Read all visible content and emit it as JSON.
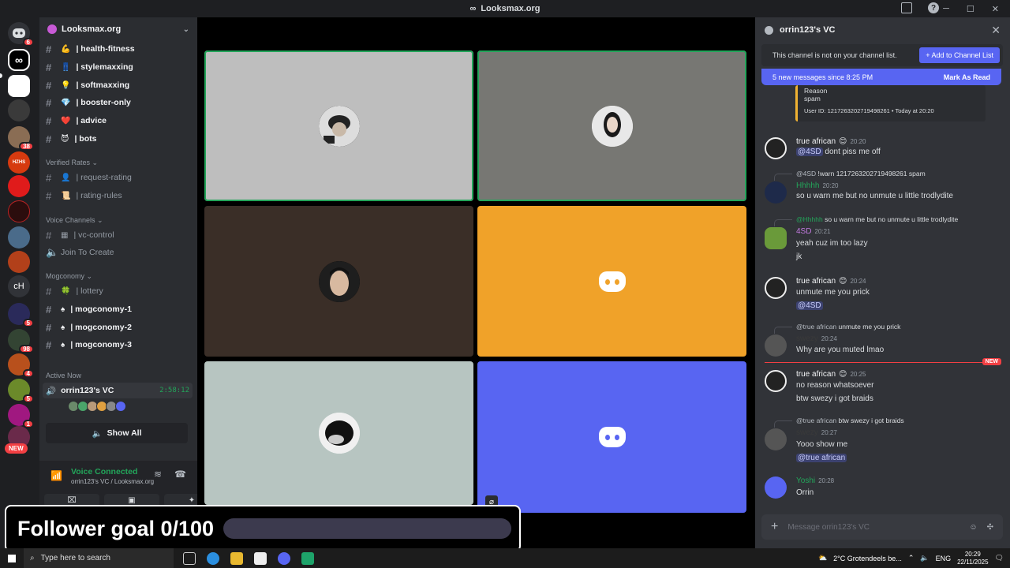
{
  "window": {
    "title": "Looksmax.org"
  },
  "rail": {
    "badges": [
      "6",
      "38",
      "5",
      "98",
      "4",
      "5",
      "1"
    ],
    "text_server": "cH",
    "new_label": "NEW"
  },
  "sidebar": {
    "guild_name": "Looksmax.org",
    "channels_top": [
      {
        "emoji": "💪",
        "label": "| health-fitness"
      },
      {
        "emoji": "👖",
        "label": "| stylemaxxing"
      },
      {
        "emoji": "💡",
        "label": "| softmaxxing"
      },
      {
        "emoji": "💎",
        "label": "| booster-only"
      },
      {
        "emoji": "❤️",
        "label": "| advice"
      },
      {
        "emoji": "😈",
        "label": "| bots"
      }
    ],
    "cat_verified": "Verified Rates ⌄",
    "channels_verified": [
      {
        "emoji": "👤",
        "label": "| request-rating"
      },
      {
        "emoji": "📜",
        "label": "| rating-rules"
      }
    ],
    "cat_voice": "Voice Channels ⌄",
    "vc_control": "| vc-control",
    "join_to_create": "Join To Create",
    "cat_mog": "Mogconomy ⌄",
    "lottery": "| lottery",
    "mog_channels": [
      "| mogconomy-1",
      "| mogconomy-2",
      "| mogconomy-3"
    ],
    "active_now": "Active Now",
    "active_vc": "orrin123's VC",
    "active_timer": "2:58:12",
    "show_all": "Show All"
  },
  "voice": {
    "status": "Voice Connected",
    "sub": "orrin123's VC / Looksmax.org"
  },
  "goal": {
    "text": "Follower goal 0/100",
    "current": 0,
    "target": 100
  },
  "chat": {
    "title": "orrin123's VC",
    "notice": "This channel is not on your channel list.",
    "add_btn": "+ Add to Channel List",
    "unread": "5 new messages since 8:25 PM",
    "mark_read": "Mark As Read",
    "embed_reason_label": "Reason",
    "embed_reason": "spam",
    "embed_uid": "User ID: 1217263202719498261 • Today at 20:20",
    "messages": [
      {
        "name": "true african",
        "badge": "😊",
        "time": "20:20",
        "lines": [
          "@4SD",
          " dont piss me off"
        ]
      },
      {
        "reply_name": "@4SD",
        "reply_text": "!warn 1217263202719498261 spam",
        "name": "Hhhhh",
        "time": "20:20",
        "lines": [
          "so u warn me but no unmute u little trodlydite"
        ]
      },
      {
        "reply_name": "@Hhhhh",
        "reply_text": "so u warn me but no unmute u little trodlydite",
        "name": "4SD",
        "time": "20:21",
        "lines": [
          "yeah cuz im too lazy",
          "jk"
        ]
      },
      {
        "name": "true african",
        "badge": "😊",
        "time": "20:24",
        "lines": [
          "unmute me you prick",
          "@4SD"
        ]
      },
      {
        "reply_name": "@true african",
        "reply_text": "unmute me you prick",
        "name": "swezy",
        "time": "20:24",
        "lines": [
          "Why are you muted lmao"
        ]
      },
      {
        "name": "true african",
        "badge": "😊",
        "time": "20:25",
        "lines": [
          "no reason whatsoever",
          "btw swezy i got braids"
        ]
      },
      {
        "reply_name": "@true african",
        "reply_text": "btw swezy i got braids",
        "name": "swezy",
        "time": "20:27",
        "lines": [
          "Yooo show me",
          "@true african"
        ]
      },
      {
        "name": "Yoshi",
        "time": "20:28",
        "lines": [
          "Orrin"
        ]
      }
    ],
    "new_label": "NEW",
    "placeholder": "Message orrin123's VC"
  },
  "taskbar": {
    "search": "Type here to search",
    "weather": "2°C  Grotendeels be...",
    "lang": "ENG",
    "time": "20:29",
    "date": "22/11/2025"
  },
  "colors": {
    "blurple": "#5865f2",
    "orange": "#f0a229",
    "green": "#23a55a",
    "red": "#f23f43"
  }
}
